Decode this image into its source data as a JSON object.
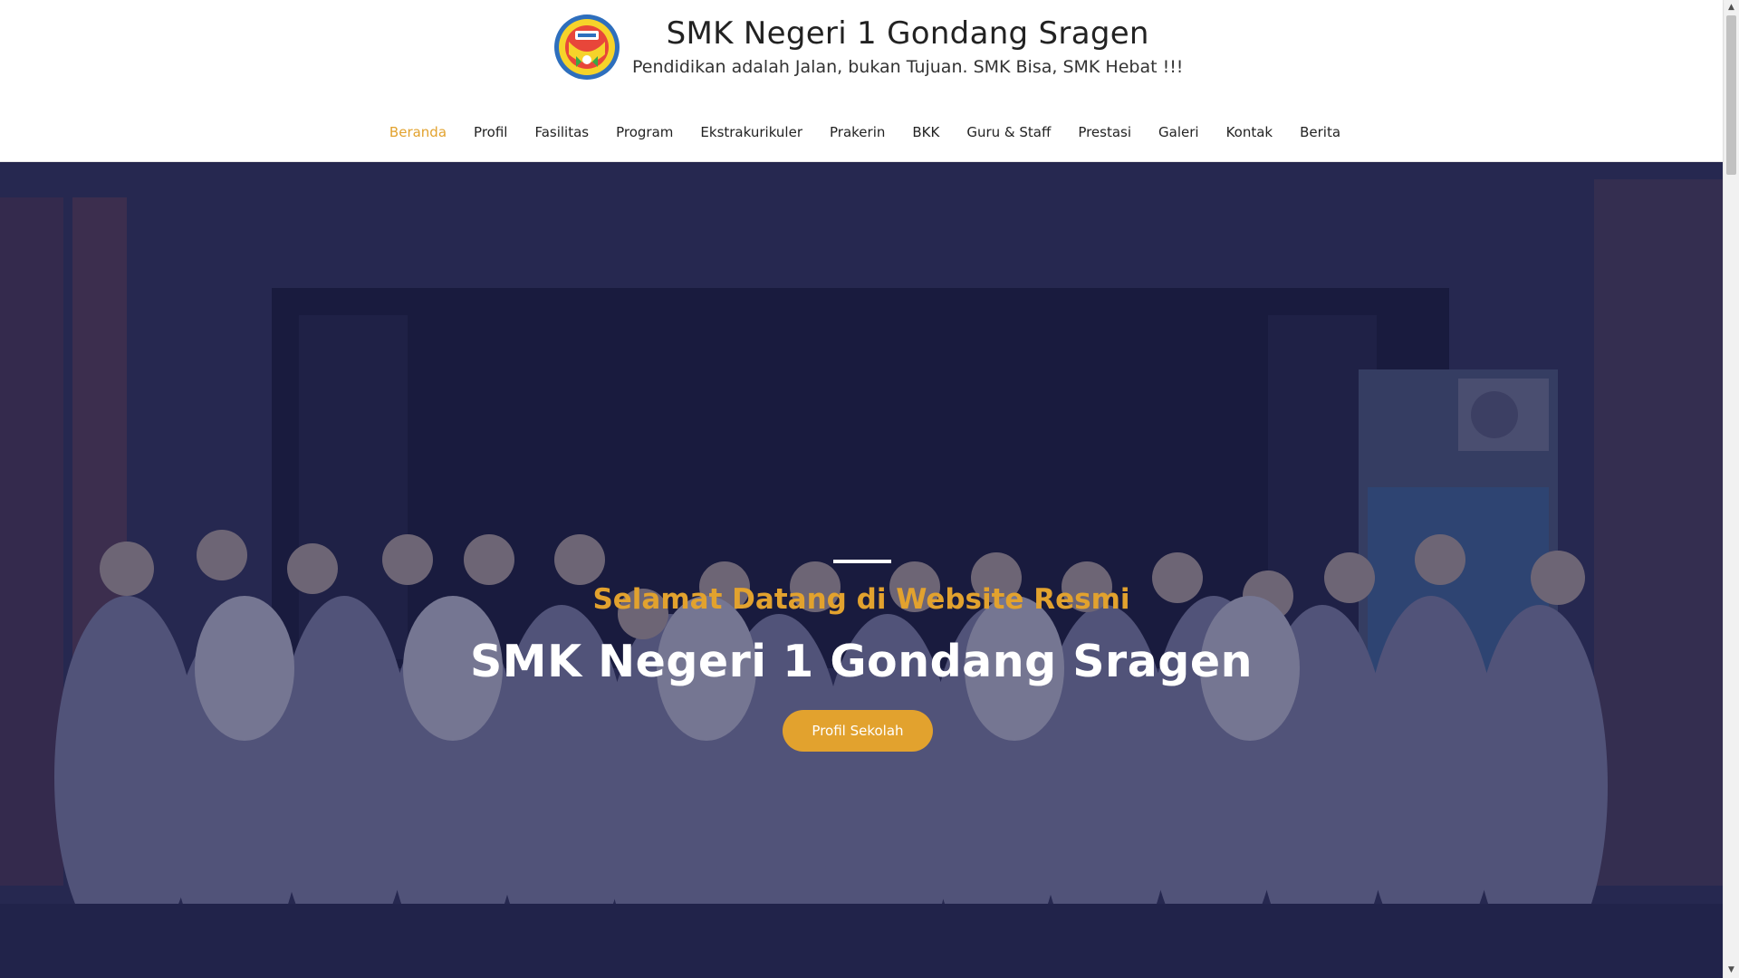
{
  "header": {
    "site_title": "SMK Negeri 1 Gondang Sragen",
    "tagline": "Pendidikan adalah Jalan, bukan Tujuan. SMK Bisa, SMK Hebat !!!",
    "logo_icon": "school-emblem-icon"
  },
  "nav": {
    "items": [
      {
        "label": "Beranda",
        "active": true
      },
      {
        "label": "Profil"
      },
      {
        "label": "Fasilitas"
      },
      {
        "label": "Program"
      },
      {
        "label": "Ekstrakurikuler"
      },
      {
        "label": "Prakerin"
      },
      {
        "label": "BKK"
      },
      {
        "label": "Guru & Staff"
      },
      {
        "label": "Prestasi"
      },
      {
        "label": "Galeri"
      },
      {
        "label": "Kontak"
      },
      {
        "label": "Berita"
      }
    ]
  },
  "hero": {
    "kicker": "Selamat Datang di Website Resmi",
    "title": "SMK Negeri 1 Gondang Sragen",
    "button_label": "Profil Sekolah",
    "image": "group-photo-of-teachers-and-staff"
  },
  "colors": {
    "accent": "#e2a22e",
    "overlay": "#16184680",
    "text_dark": "#222222"
  }
}
